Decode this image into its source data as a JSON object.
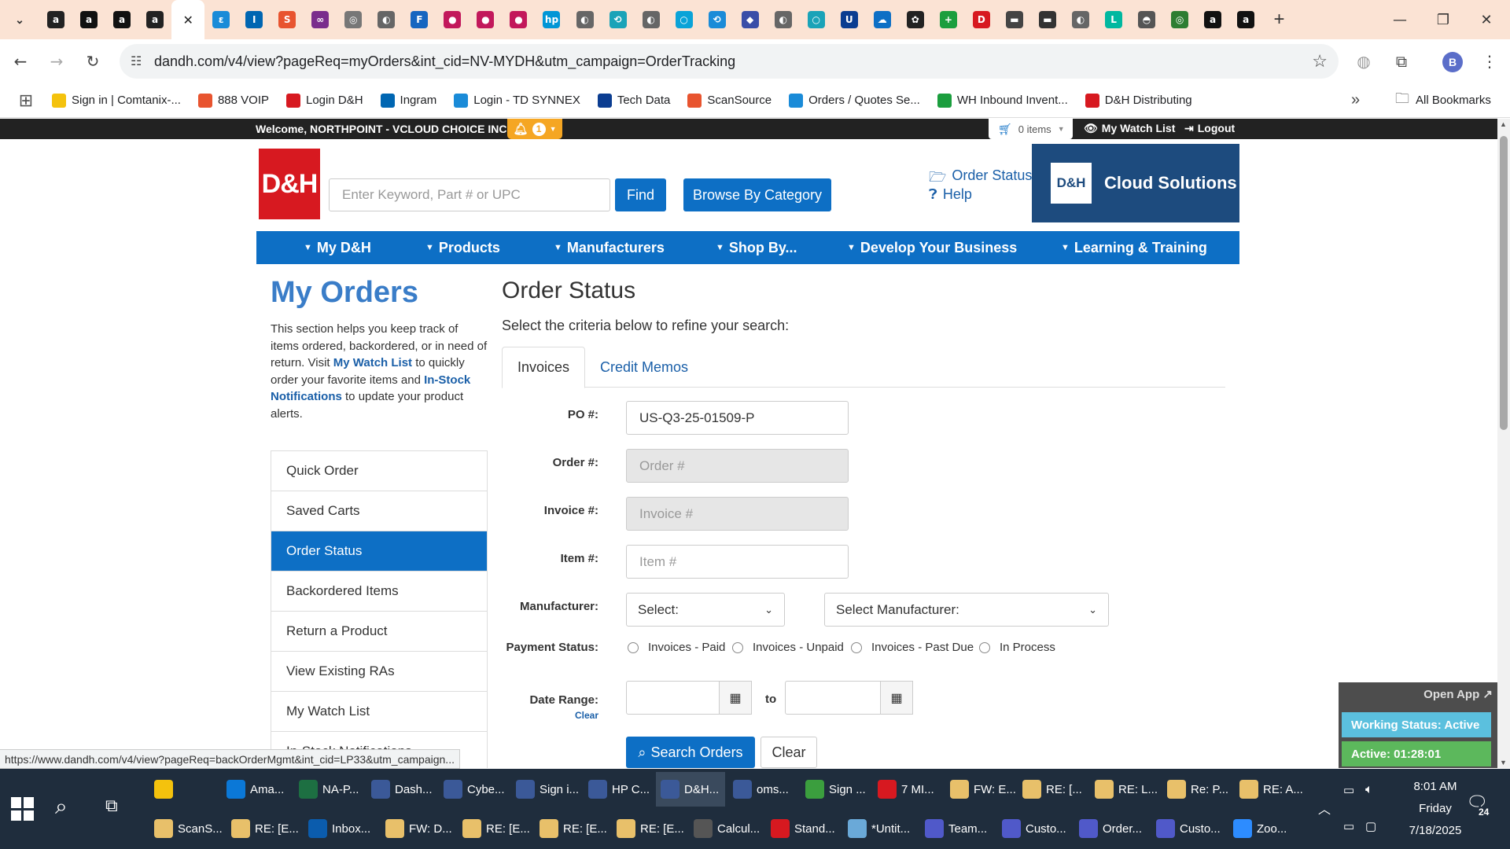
{
  "browser": {
    "url": "dandh.com/v4/view?pageReq=myOrders&int_cid=NV-MYDH&utm_campaign=OrderTracking",
    "profile_initial": "B",
    "status_url": "https://www.dandh.com/v4/view?pageReq=backOrderMgmt&int_cid=LP33&utm_campaign...",
    "tab_icons": [
      {
        "name": "amazon-a-tab-icon",
        "glyph": "a",
        "color": "#222"
      },
      {
        "name": "amazon-tab-icon",
        "glyph": "a",
        "color": "#111"
      },
      {
        "name": "amazon-tab-icon",
        "glyph": "a",
        "color": "#111"
      },
      {
        "name": "amazon-a-tab-icon",
        "glyph": "a",
        "color": "#222"
      },
      {
        "name": "dh-active-tab-icon",
        "glyph": "✕",
        "color": "#fff"
      },
      {
        "name": "ec-tab-icon",
        "glyph": "ε",
        "color": "#1a8bd8"
      },
      {
        "name": "ingram-tab-icon",
        "glyph": "I",
        "color": "#0066b2"
      },
      {
        "name": "scansource-tab-icon",
        "glyph": "S",
        "color": "#e8542f"
      },
      {
        "name": "link-tab-icon",
        "glyph": "∞",
        "color": "#7a2d8c"
      },
      {
        "name": "globe-tab-icon",
        "glyph": "◎",
        "color": "#777"
      },
      {
        "name": "globe-tab-icon",
        "glyph": "◐",
        "color": "#666"
      },
      {
        "name": "f-tab-icon",
        "glyph": "F",
        "color": "#1565c0"
      },
      {
        "name": "red-circle-tab-icon",
        "glyph": "●",
        "color": "#c2185b"
      },
      {
        "name": "red-circle-tab-icon",
        "glyph": "●",
        "color": "#c2185b"
      },
      {
        "name": "red-circle-tab-icon",
        "glyph": "●",
        "color": "#c2185b"
      },
      {
        "name": "hp-tab-icon",
        "glyph": "hp",
        "color": "#0096d6"
      },
      {
        "name": "globe-tab-icon",
        "glyph": "◐",
        "color": "#666"
      },
      {
        "name": "sync-tab-icon",
        "glyph": "⟲",
        "color": "#1aa3b8"
      },
      {
        "name": "globe-tab-icon",
        "glyph": "◐",
        "color": "#666"
      },
      {
        "name": "circle-tab-icon",
        "glyph": "○",
        "color": "#0aa3d8"
      },
      {
        "name": "sync-tab-icon",
        "glyph": "⟲",
        "color": "#1a8bd8"
      },
      {
        "name": "shield-tab-icon",
        "glyph": "◆",
        "color": "#3a4ea8"
      },
      {
        "name": "globe-tab-icon",
        "glyph": "◐",
        "color": "#666"
      },
      {
        "name": "circle-tab-icon",
        "glyph": "○",
        "color": "#1aa3b8"
      },
      {
        "name": "u-tab-icon",
        "glyph": "U",
        "color": "#0b3d91"
      },
      {
        "name": "cloud-tab-icon",
        "glyph": "☁",
        "color": "#0d6fc5"
      },
      {
        "name": "openai-tab-icon",
        "glyph": "✿",
        "color": "#222"
      },
      {
        "name": "plus-green-tab-icon",
        "glyph": "+",
        "color": "#1b9e3e"
      },
      {
        "name": "dh-tab-icon",
        "glyph": "D",
        "color": "#d71920"
      },
      {
        "name": "boat-tab-icon",
        "glyph": "▬",
        "color": "#444"
      },
      {
        "name": "ship-tab-icon",
        "glyph": "▬",
        "color": "#333"
      },
      {
        "name": "globe-tab-icon",
        "glyph": "◐",
        "color": "#666"
      },
      {
        "name": "logi-tab-icon",
        "glyph": "L",
        "color": "#00b8a0"
      },
      {
        "name": "car-tab-icon",
        "glyph": "◓",
        "color": "#555"
      },
      {
        "name": "circle-tab-icon",
        "glyph": "◎",
        "color": "#2e7d32"
      },
      {
        "name": "amazon-tab-icon",
        "glyph": "a",
        "color": "#111"
      },
      {
        "name": "amazon-tab-icon",
        "glyph": "a",
        "color": "#111"
      }
    ]
  },
  "bookmarks": {
    "items": [
      {
        "label": "Sign in | Comtanix-...",
        "color": "#f4c20d"
      },
      {
        "label": "888 VOIP",
        "color": "#e8542f"
      },
      {
        "label": "Login D&H",
        "color": "#d71920"
      },
      {
        "label": "Ingram",
        "color": "#0066b2"
      },
      {
        "label": "Login - TD SYNNEX",
        "color": "#1a8bd8"
      },
      {
        "label": "Tech Data",
        "color": "#0b3d91"
      },
      {
        "label": "ScanSource",
        "color": "#e8542f"
      },
      {
        "label": "Orders / Quotes Se...",
        "color": "#1a8bd8"
      },
      {
        "label": "WH Inbound Invent...",
        "color": "#1b9e3e"
      },
      {
        "label": "D&H Distributing",
        "color": "#d71920"
      }
    ],
    "all_label": "All Bookmarks"
  },
  "site": {
    "welcome": "Welcome, NORTHPOINT - VCLOUD CHOICE INC",
    "notif_count": "1",
    "cart": "0 items",
    "watch_list": "My Watch List",
    "logout": "Logout",
    "logo_text": "D&H",
    "search_placeholder": "Enter Keyword, Part # or UPC",
    "find": "Find",
    "browse": "Browse By Category",
    "order_status_link": "Order Status",
    "help": "Help",
    "cloud_banner": "Cloud Solutions",
    "nav": [
      "My D&H",
      "Products",
      "Manufacturers",
      "Shop By...",
      "Develop Your Business",
      "Learning & Training"
    ]
  },
  "left": {
    "title": "My Orders",
    "intro_1": "This section helps you keep track of items ordered, backordered, or in need of return. Visit ",
    "intro_link1": "My Watch List",
    "intro_2": " to quickly order your favorite items and ",
    "intro_link2": "In-Stock Notifications",
    "intro_3": " to update your product alerts.",
    "menu": [
      "Quick Order",
      "Saved Carts",
      "Order Status",
      "Backordered Items",
      "Return a Product",
      "View Existing RAs",
      "My Watch List",
      "In-Stock Notifications"
    ]
  },
  "form": {
    "title": "Order Status",
    "subtitle": "Select the criteria below to refine your search:",
    "tabs": [
      "Invoices",
      "Credit Memos"
    ],
    "po_label": "PO #:",
    "po_value": "US-Q3-25-01509-P",
    "order_label": "Order #:",
    "order_ph": "Order #",
    "invoice_label": "Invoice #:",
    "invoice_ph": "Invoice #",
    "item_label": "Item #:",
    "item_ph": "Item #",
    "mfr_label": "Manufacturer:",
    "mfr_select1": "Select:",
    "mfr_select2": "Select Manufacturer:",
    "pay_label": "Payment Status:",
    "pay_options": [
      "Invoices - Paid",
      "Invoices - Unpaid",
      "Invoices - Past Due",
      "In Process"
    ],
    "date_label": "Date Range:",
    "date_clear": "Clear",
    "to": "to",
    "search_btn": "Search Orders",
    "clear_btn": "Clear"
  },
  "widget": {
    "open_app": "Open App ↗",
    "working_status": "Working Status: Active",
    "active_time": "Active: 01:28:01"
  },
  "taskbar": {
    "row1": [
      {
        "label": "",
        "color": "#f4c20d",
        "name": "file-explorer-task"
      },
      {
        "label": "Ama...",
        "color": "#0b78d7",
        "name": "edge-amazon-task"
      },
      {
        "label": "NA-P...",
        "color": "#1d6f42",
        "name": "excel-task"
      },
      {
        "label": "Dash...",
        "color": "#3b5998",
        "name": "chrome-dash-task"
      },
      {
        "label": "Cybe...",
        "color": "#3b5998",
        "name": "chrome-cyber-task"
      },
      {
        "label": "Sign i...",
        "color": "#3b5998",
        "name": "chrome-signin-task"
      },
      {
        "label": "HP C...",
        "color": "#3b5998",
        "name": "chrome-hp-task"
      },
      {
        "label": "D&H...",
        "color": "#3b5998",
        "name": "chrome-dh-task"
      },
      {
        "label": "oms...",
        "color": "#3b5998",
        "name": "chrome-oms-task"
      },
      {
        "label": "Sign ...",
        "color": "#3b9e3e",
        "name": "chrome-sign-task"
      },
      {
        "label": "7 MI...",
        "color": "#d71920",
        "name": "chrome-7mi-task"
      },
      {
        "label": "FW: E...",
        "color": "#e8c06a",
        "name": "mail-fw-e-task"
      },
      {
        "label": "RE: [...",
        "color": "#e8c06a",
        "name": "mail-re-task"
      },
      {
        "label": "RE: L...",
        "color": "#e8c06a",
        "name": "mail-re-l-task"
      },
      {
        "label": "Re: P...",
        "color": "#e8c06a",
        "name": "mail-re-p-task"
      },
      {
        "label": "RE: A...",
        "color": "#e8c06a",
        "name": "mail-re-a-task"
      }
    ],
    "row2": [
      {
        "label": "ScanS...",
        "color": "#e8c06a",
        "name": "mail-scans-task"
      },
      {
        "label": "RE: [E...",
        "color": "#e8c06a",
        "name": "mail-re-e1-task"
      },
      {
        "label": "Inbox...",
        "color": "#0b5cad",
        "name": "outlook-inbox-task"
      },
      {
        "label": "FW: D...",
        "color": "#e8c06a",
        "name": "mail-fw-d-task"
      },
      {
        "label": "RE: [E...",
        "color": "#e8c06a",
        "name": "mail-re-e2-task"
      },
      {
        "label": "RE: [E...",
        "color": "#e8c06a",
        "name": "mail-re-e3-task"
      },
      {
        "label": "RE: [E...",
        "color": "#e8c06a",
        "name": "mail-re-e4-task"
      },
      {
        "label": "Calcul...",
        "color": "#555",
        "name": "calculator-task"
      },
      {
        "label": "Stand...",
        "color": "#d71920",
        "name": "pdf-stand-task"
      },
      {
        "label": "*Untit...",
        "color": "#6aa9d8",
        "name": "notepad-untitled-task"
      },
      {
        "label": "Team...",
        "color": "#5059c9",
        "name": "teams-task"
      },
      {
        "label": "Custo...",
        "color": "#5059c9",
        "name": "teams-custo-task"
      },
      {
        "label": "Order...",
        "color": "#5059c9",
        "name": "teams-order-task"
      },
      {
        "label": "Custo...",
        "color": "#5059c9",
        "name": "teams-custo2-task"
      },
      {
        "label": "Zoo...",
        "color": "#2d8cff",
        "name": "zoom-task"
      }
    ],
    "time": "8:01 AM",
    "day": "Friday",
    "date": "7/18/2025",
    "notif_badge": "24"
  }
}
